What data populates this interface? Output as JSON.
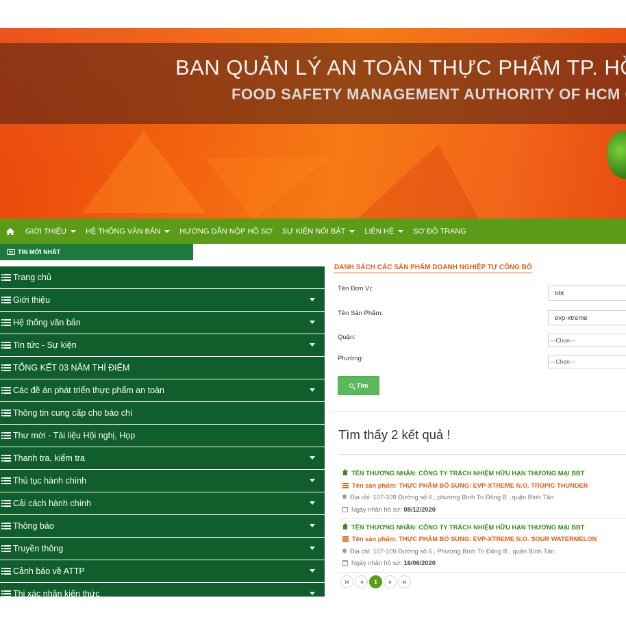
{
  "banner": {
    "title_vn": "BAN QUẢN LÝ AN TOÀN THỰC PHẨM TP. HỒ CHÍ MINH",
    "title_en": "FOOD SAFETY MANAGEMENT AUTHORITY OF HCM CITY"
  },
  "nav": {
    "items": [
      {
        "label": "GIỚI THIỆU"
      },
      {
        "label": "HỆ THỐNG VĂN BẢN"
      },
      {
        "label": "HƯỚNG DẪN NỘP HỒ SƠ"
      },
      {
        "label": "SỰ KIỆN NỔI BẬT"
      },
      {
        "label": "LIÊN HỆ"
      },
      {
        "label": "SƠ ĐỒ TRANG"
      }
    ]
  },
  "ticker": {
    "label": "TIN MỚI NHẤT"
  },
  "sidebar": {
    "items": [
      {
        "label": "Trang chủ"
      },
      {
        "label": "Giới thiệu"
      },
      {
        "label": "Hệ thống văn bản"
      },
      {
        "label": "Tin tức - Sự kiện"
      },
      {
        "label": "TỔNG KẾT 03 NĂM THÍ ĐIỂM"
      },
      {
        "label": "Các đề án phát triển thực phẩm an toàn"
      },
      {
        "label": "Thông tin cung cấp cho báo chí"
      },
      {
        "label": "Thư mời - Tài liệu Hội nghị, Họp"
      },
      {
        "label": "Thanh tra, kiểm tra"
      },
      {
        "label": "Thủ tục hành chính"
      },
      {
        "label": "Cải cách hành chính"
      },
      {
        "label": "Thông báo"
      },
      {
        "label": "Truyền thông"
      },
      {
        "label": "Cảnh báo về ATTP"
      },
      {
        "label": "Thi xác nhận kiến thức"
      }
    ]
  },
  "search": {
    "title": "DANH SÁCH CÁC SẢN PHẨM DOANH NGHIỆP TỰ CÔNG BỐ",
    "unit_label": "Tên Đơn Vị:",
    "unit_value": "bbt",
    "product_label": "Tên Sản Phẩm:",
    "product_value": "evp-xtreme",
    "district_label": "Quận:",
    "district_value": "---Chọn---",
    "ward_label": "Phường:",
    "ward_value": "---Chọn---",
    "button_label": "Tìm"
  },
  "results": {
    "count_text": "Tìm thấy 2 kết quả !",
    "items": [
      {
        "merchant": "TÊN THƯƠNG NHÂN: CÔNG TY TRÁCH NHIỆM HỮU HẠN THƯƠNG MẠI BBT",
        "product": "Tên sản phẩm: THỰC PHẨM BỔ SUNG: EVP-XTREME N.O. TROPIC THUNDER",
        "address": "Địa chỉ: 107-109 Đường số 6 , phường Bình Trị Đông B , quận Bình Tân",
        "date_label": "Ngày nhận hồ sơ:",
        "date": "08/12/2020"
      },
      {
        "merchant": "TÊN THƯƠNG NHÂN: CÔNG TY TRÁCH NHIỆM HỮU HẠN THƯƠNG MẠI BBT",
        "product": "Tên sản phẩm: THỰC PHẨM BỔ SUNG: EVP-XTREME N.O. SOUR WATERMELON",
        "address": "Địa chỉ: 107-109 Đường số 6 , Phường Bình Trị Đông B , quận Bình Tân",
        "date_label": "Ngày nhận hồ sơ:",
        "date": "16/06/2020"
      }
    ]
  },
  "pagination": {
    "current": "1"
  }
}
